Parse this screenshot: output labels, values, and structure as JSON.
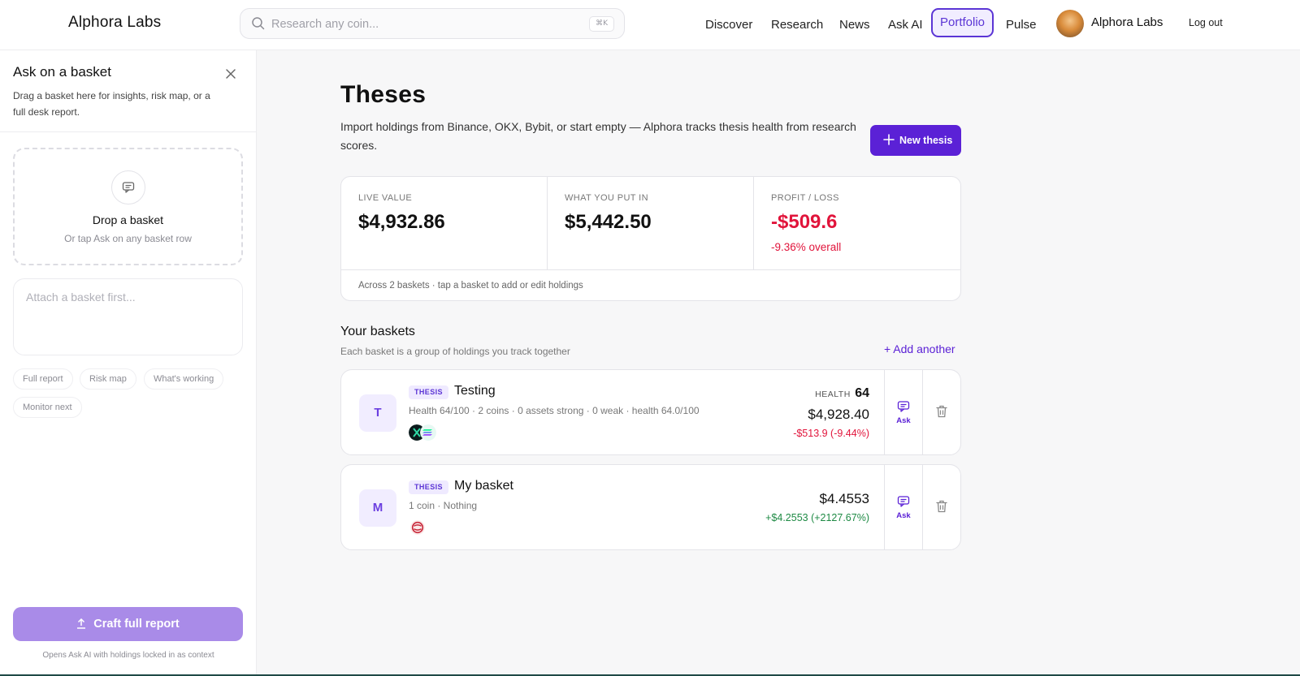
{
  "header": {
    "brand": "Alphora Labs",
    "search_placeholder": "Research any coin...",
    "search_shortcut": "⌘K",
    "nav": [
      {
        "label": "Discover",
        "active": false
      },
      {
        "label": "Research",
        "active": false
      },
      {
        "label": "News",
        "active": false
      },
      {
        "label": "Ask AI",
        "active": false
      },
      {
        "label": "Portfolio",
        "active": true
      },
      {
        "label": "Pulse",
        "active": false
      }
    ],
    "user_name": "Alphora Labs",
    "logout_label": "Log out"
  },
  "sidebar": {
    "title": "Ask on a basket",
    "description": "Drag a basket here for insights, risk map, or a full desk report.",
    "dropzone_title": "Drop a basket",
    "dropzone_sub": "Or tap Ask on any basket row",
    "input_placeholder": "Attach a basket first...",
    "chips": [
      "Full report",
      "Risk map",
      "What's working",
      "Monitor next"
    ],
    "craft_label": "Craft full report",
    "craft_note": "Opens Ask AI with holdings locked in as context"
  },
  "main": {
    "title": "Theses",
    "description": "Import holdings from Binance, OKX, Bybit, or start empty — Alphora tracks thesis health from research scores.",
    "new_thesis_label": "New thesis",
    "stats": {
      "live_label": "LIVE VALUE",
      "live_value": "$4,932.86",
      "put_label": "WHAT YOU PUT IN",
      "put_value": "$5,442.50",
      "pl_label": "PROFIT / LOSS",
      "pl_value": "-$509.6",
      "pl_sub": "-9.36% overall",
      "footer": "Across 2 baskets · tap a basket to add or edit holdings"
    },
    "baskets_title": "Your baskets",
    "baskets_sub": "Each basket is a group of holdings you track together",
    "add_another": "+ Add another",
    "baskets": [
      {
        "letter": "T",
        "tag": "THESIS",
        "name": "Testing",
        "meta": "Health 64/100 · 2 coins · 0 assets strong · 0 weak · health 64.0/100",
        "health_label": "HEALTH",
        "health_value": "64",
        "value": "$4,928.40",
        "change": "-$513.9 (-9.44%)",
        "ask_label": "Ask"
      },
      {
        "letter": "M",
        "tag": "THESIS",
        "name": "My basket",
        "meta": "1 coin · Nothing",
        "value": "$4.4553",
        "change": "+$4.2553 (+2127.67%)",
        "ask_label": "Ask"
      }
    ]
  },
  "colors": {
    "accent": "#5b21d6",
    "negative": "#e1143b",
    "positive": "#1e8a44"
  }
}
